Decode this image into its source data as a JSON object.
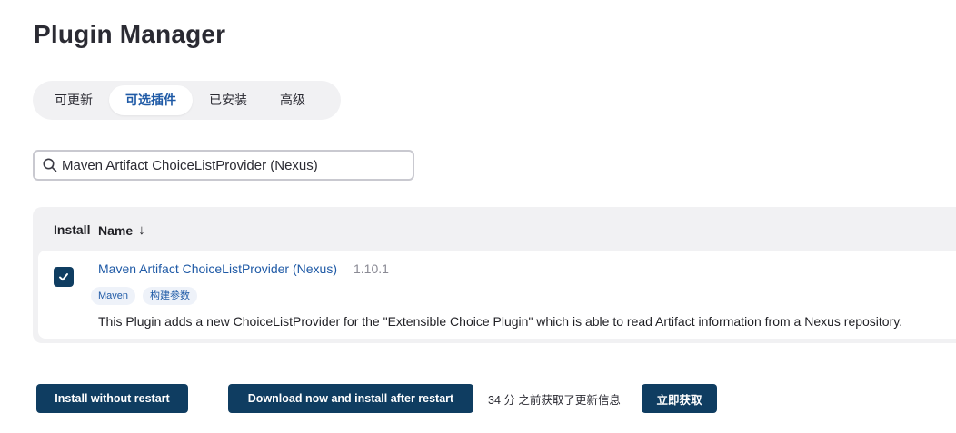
{
  "page": {
    "title": "Plugin Manager"
  },
  "tabs": [
    {
      "label": "可更新",
      "active": false
    },
    {
      "label": "可选插件",
      "active": true
    },
    {
      "label": "已安装",
      "active": false
    },
    {
      "label": "高级",
      "active": false
    }
  ],
  "search": {
    "value": "Maven Artifact ChoiceListProvider (Nexus)",
    "icon": "search-icon"
  },
  "table": {
    "headers": {
      "install": "Install",
      "name": "Name",
      "sort_indicator": "↓"
    },
    "rows": [
      {
        "checked": true,
        "name": "Maven Artifact ChoiceListProvider (Nexus)",
        "version": "1.10.1",
        "tags": [
          "Maven",
          "构建参数"
        ],
        "description": "This Plugin adds a new ChoiceListProvider for the \"Extensible Choice Plugin\" which is able to read Artifact information from a Nexus repository."
      }
    ]
  },
  "actions": {
    "install_without_restart": "Install without restart",
    "download_install_after_restart": "Download now and install after restart",
    "updated_info": "34 分 之前获取了更新信息",
    "refresh_now": "立即获取"
  },
  "colors": {
    "primary": "#0f3d61",
    "link": "#1f5aa6",
    "panel": "#f1f1f3"
  }
}
